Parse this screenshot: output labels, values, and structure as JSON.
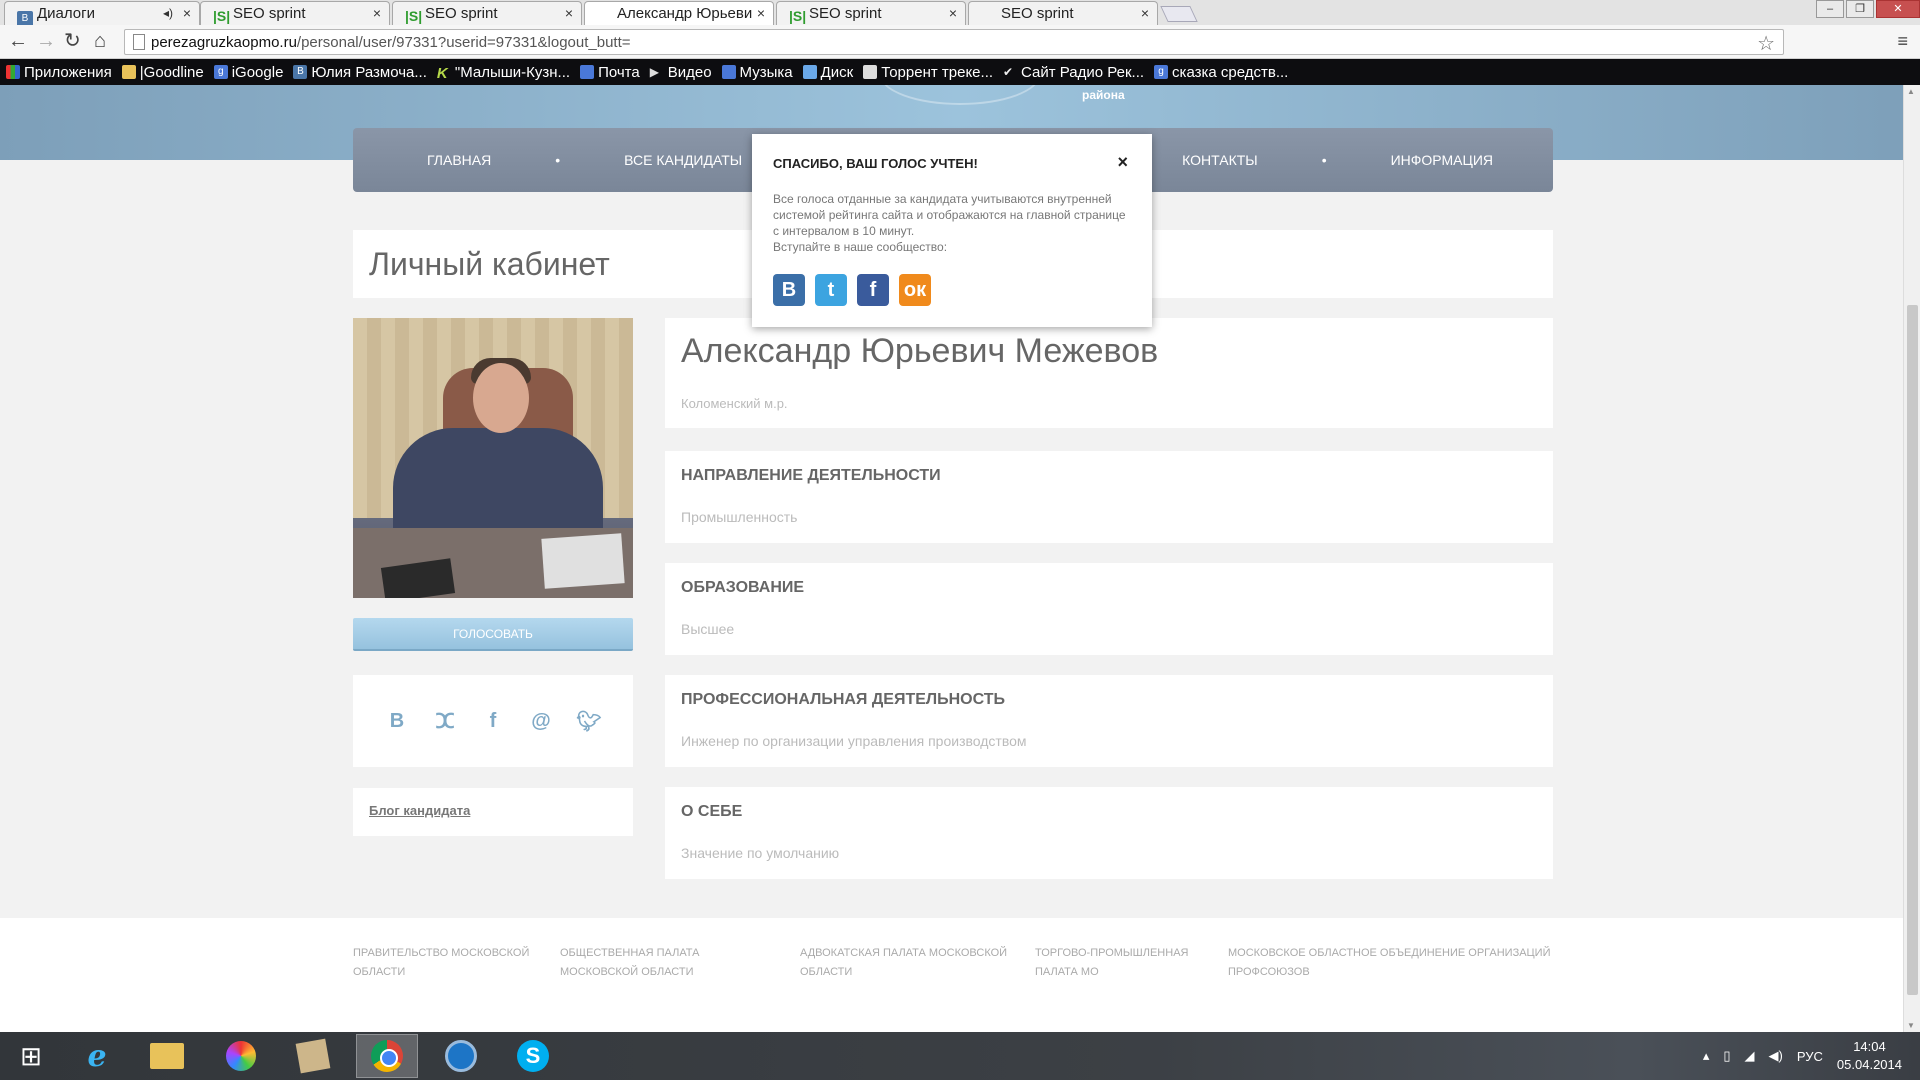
{
  "browser": {
    "tabs": [
      {
        "label": "Диалоги",
        "icon": "vk-icon"
      },
      {
        "label": "SEO sprint",
        "icon": "seosprint-icon"
      },
      {
        "label": "SEO sprint",
        "icon": "seosprint-icon"
      },
      {
        "label": "Александр Юрьеви",
        "icon": "page-icon",
        "active": true
      },
      {
        "label": "SEO sprint",
        "icon": "seosprint-icon"
      },
      {
        "label": "SEO sprint",
        "icon": "page-icon"
      }
    ],
    "url_host": "perezagruzkaopmo.ru",
    "url_path": "/personal/user/97331?userid=97331&logout_butt=",
    "bookmarks": [
      {
        "label": "Приложения",
        "icon": "apps-icon"
      },
      {
        "label": "|Goodline",
        "icon": "folder-icon"
      },
      {
        "label": "iGoogle",
        "icon": "google-icon"
      },
      {
        "label": "Юлия Размоча...",
        "icon": "vk-icon"
      },
      {
        "label": "\"Малыши-Кузн...",
        "icon": "k-icon"
      },
      {
        "label": "Почта",
        "icon": "mail-icon"
      },
      {
        "label": "Видео",
        "icon": "play-icon"
      },
      {
        "label": "Музыка",
        "icon": "music-icon"
      },
      {
        "label": "Диск",
        "icon": "disk-icon"
      },
      {
        "label": "Торрент треке...",
        "icon": "torrent-icon"
      },
      {
        "label": "Сайт Радио Рек...",
        "icon": "radio-icon"
      },
      {
        "label": "сказка средств...",
        "icon": "google-icon"
      }
    ]
  },
  "site": {
    "header_district": "района",
    "nav": [
      "Главная",
      "Все кандидаты",
      "",
      "Контакты",
      "Информация"
    ],
    "page_title": "Личный кабинет",
    "vote_button": "Голосовать",
    "social_icons": [
      "В",
      "ок",
      "f",
      "@",
      "tw"
    ],
    "blog_link": "Блог кандидата",
    "candidate": {
      "name": "Александр Юрьевич Межевов",
      "location": "Коломенский м.р."
    },
    "info": [
      {
        "heading": "Направление деятельности",
        "value": "Промышленность"
      },
      {
        "heading": "Образование",
        "value": "Высшее"
      },
      {
        "heading": "Профессиональная деятельность",
        "value": "Инженер по организации управления производством"
      },
      {
        "heading": "О себе",
        "value": "Значение по умолчанию"
      }
    ],
    "footer_links": [
      "Правительство Московской области",
      "Общественная палата Московской области",
      "Адвокатская палата Московской области",
      "Торгово-промышленная палата МО",
      "Московское областное объединение организаций профсоюзов"
    ]
  },
  "modal": {
    "title": "Спасибо, ваш голос учтен!",
    "close": "×",
    "body": "Все голоса отданные за кандидата учитываются внутренней системой рейтинга сайта и отображаются на главной странице с интервалом в 10 минут.",
    "join": "Вступайте в наше сообщество:",
    "social": [
      "vk",
      "twitter",
      "facebook",
      "odnoklassniki"
    ]
  },
  "taskbar": {
    "language": "РУС",
    "time": "14:04",
    "date": "05.04.2014"
  }
}
